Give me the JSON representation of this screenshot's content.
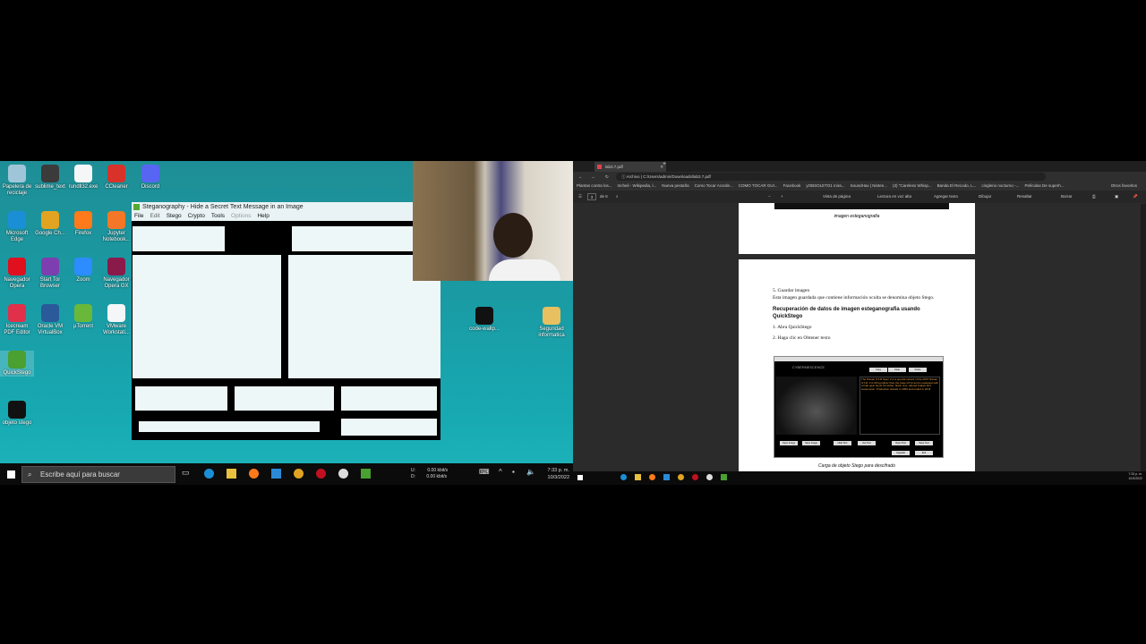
{
  "desktop": {
    "icons": [
      {
        "label": "Papelera de reciclaje",
        "icon": "recycle-bin-icon",
        "color": "#9fc6d8"
      },
      {
        "label": "sublime_text",
        "icon": "sublime-icon",
        "color": "#3b3b3b"
      },
      {
        "label": "rundll32.exe",
        "icon": "file-icon",
        "color": "#f4f6f8"
      },
      {
        "label": "CCleaner",
        "icon": "ccleaner-icon",
        "color": "#d8322a"
      },
      {
        "label": "Discord",
        "icon": "discord-icon",
        "color": "#5865f2"
      },
      {
        "label": "Microsoft Edge",
        "icon": "edge-icon",
        "color": "#1b8fd6"
      },
      {
        "label": "Google Ch...",
        "icon": "chrome-icon",
        "color": "#e0a422"
      },
      {
        "label": "Firefox",
        "icon": "firefox-icon",
        "color": "#ff7a1a"
      },
      {
        "label": "Jupyter Notebook...",
        "icon": "jupyter-icon",
        "color": "#f37726"
      },
      {
        "label": "Navegador Opera",
        "icon": "opera-icon",
        "color": "#e0101e"
      },
      {
        "label": "Start Tor Browser",
        "icon": "tor-icon",
        "color": "#7d3fb0"
      },
      {
        "label": "Zoom",
        "icon": "zoom-icon",
        "color": "#2d8cff"
      },
      {
        "label": "Navegador Opera GX",
        "icon": "opera-gx-icon",
        "color": "#8a1a4a"
      },
      {
        "label": "Icecream PDF Editor",
        "icon": "pdf-editor-icon",
        "color": "#e0304a"
      },
      {
        "label": "Oracle VM VirtualBox",
        "icon": "virtualbox-icon",
        "color": "#2a5a9a"
      },
      {
        "label": "µTorrent",
        "icon": "utorrent-icon",
        "color": "#6ab83a"
      },
      {
        "label": "VMware Workstati...",
        "icon": "file-icon",
        "color": "#f4f6f8"
      },
      {
        "label": "QuickStego",
        "icon": "quickstego-icon",
        "color": "#4aa030"
      },
      {
        "label": "objeto stego",
        "icon": "image-file-icon",
        "color": "#111111"
      },
      {
        "label": "code-wallp...",
        "icon": "image-file-icon",
        "color": "#111111"
      },
      {
        "label": "Seguridad informatica",
        "icon": "folder-icon",
        "color": "#e8c060"
      }
    ]
  },
  "steg_window": {
    "title": "Steganography - Hide a Secret Text Message in an Image",
    "menu": [
      "File",
      "Edit",
      "Stego",
      "Crypto",
      "Tools",
      "Options",
      "Help"
    ]
  },
  "taskbar_left": {
    "search_placeholder": "Escribe aquí para buscar",
    "net_up_label": "U:",
    "net_down_label": "D:",
    "net_up": "0.00 kbit/s",
    "net_down": "0.00 kbit/s",
    "time": "7:33 p. m.",
    "date": "10/3/2022"
  },
  "browser": {
    "tab": "lab3.7.pdf",
    "address_prefix": "Archivo",
    "address": "C:/Users/admin/Downloads/lab3.7.pdf",
    "bookmarks": [
      "Plantas contra los...",
      "Incheil - Wikipedia, l...",
      "Nueva pestaña",
      "Como Tocar Acorde...",
      "COMO TOCAR GUI...",
      "Facebook",
      "yOBSOLETO1 mira...",
      "SoundHax | Ninten...",
      "(3) \"Careless Whisp...",
      "Banda El Recodo, L...",
      "cinglerio nocturno -...",
      "Películas De superh...",
      "Otros favoritos"
    ],
    "pdf_toolbar": {
      "page": "3",
      "of": "de 6",
      "items": [
        "Vista de página",
        "Lectura en voz alta",
        "Agregar texto",
        "Dibujar",
        "Resaltar",
        "Borrar"
      ]
    }
  },
  "pdf": {
    "caption1": "imagen esteganografia",
    "step5": "5. Guardar imagen",
    "para": "Esta imagen guardada que contiene información oculta se denomina objeto Stego.",
    "heading": "Recuperación de datos de imagen esteganografia usando QuickStego",
    "step1": "1. Abra QuickStego",
    "step2": "2. Haga clic en Obtener texto",
    "figure": {
      "brand": "CYBERNESCENCE",
      "text": "The Nissan GT-R Spec V is a special variant of the 2007 Nissan GT-R. It is 60 kg lighter than the base GT-R and is equipped with a high gear boost controller, black rims, altered brakes and suspension. Production started in 2009 and ended in 2011.",
      "buttons": [
        "Copy",
        "Clear",
        "Paste",
        "Open Image",
        "Save Image",
        "Hide Text",
        "Get Text",
        "Open Text",
        "Save Text",
        "Upgrade",
        "Exit"
      ]
    },
    "caption2": "Carga de objeto Stego para descifrado"
  },
  "taskbar_right": {
    "time": "7:33 p. m.",
    "date": "10/3/2022"
  }
}
